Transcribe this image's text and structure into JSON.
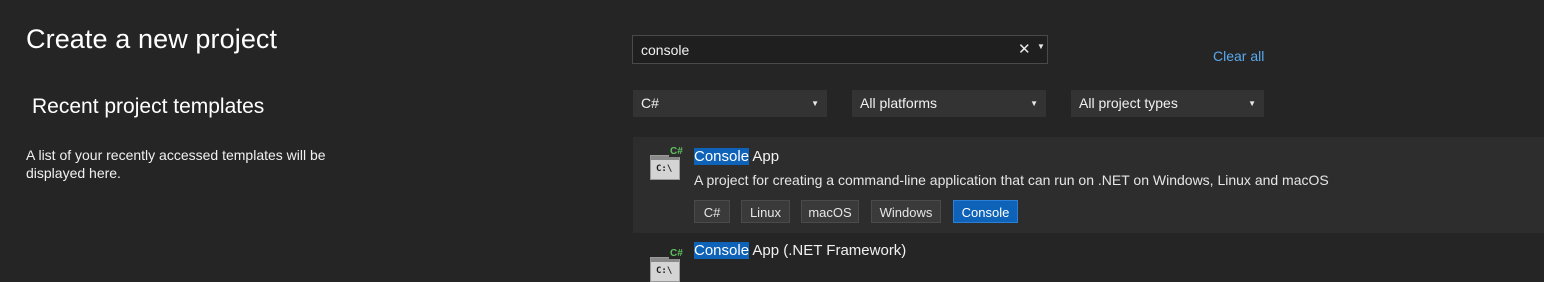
{
  "header": {
    "title": "Create a new project"
  },
  "recent": {
    "title": "Recent project templates",
    "description": "A list of your recently accessed templates will be displayed here."
  },
  "search": {
    "value": "console",
    "clear_glyph": "✕",
    "dropdown_glyph": "▼"
  },
  "clear_all_label": "Clear all",
  "filters": {
    "language": "C#",
    "platform": "All platforms",
    "project_type": "All project types",
    "arrow_glyph": "▼"
  },
  "results": [
    {
      "title_highlight": "Console",
      "title_rest": " App",
      "description": "A project for creating a command-line application that can run on .NET on Windows, Linux and macOS",
      "icon": "console-app-csharp-icon",
      "icon_badge": "C#",
      "icon_prompt": "C:\\",
      "tags": [
        "C#",
        "Linux",
        "macOS",
        "Windows",
        "Console"
      ],
      "highlighted_tag_index": 4
    },
    {
      "title_highlight": "Console",
      "title_rest": " App (.NET Framework)",
      "icon": "console-app-csharp-icon",
      "icon_badge": "C#",
      "icon_prompt": "C:\\"
    }
  ],
  "colors": {
    "background": "#252526",
    "selected_item": "#2d2d2d",
    "highlight": "#0e62b8",
    "link": "#5aa8ec",
    "csharp_badge": "#5ec25e"
  }
}
